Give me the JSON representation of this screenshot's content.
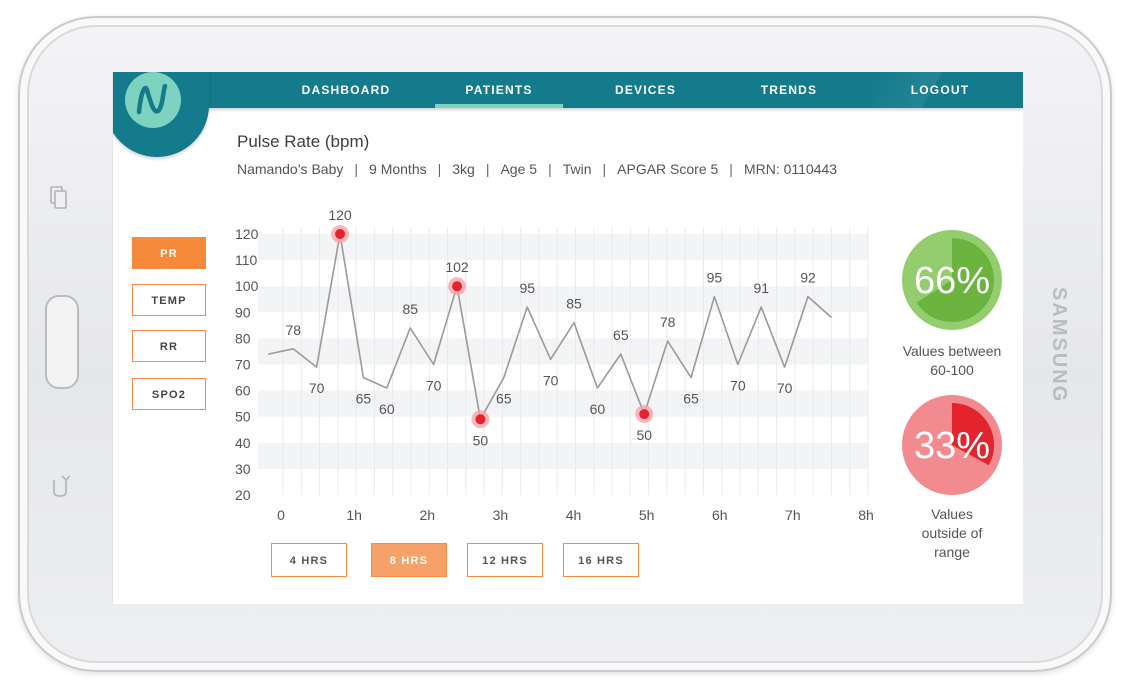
{
  "device": {
    "brand": "SAMSUNG"
  },
  "nav": {
    "items": [
      {
        "label": "DASHBOARD",
        "active": false
      },
      {
        "label": "PATIENTS",
        "active": true
      },
      {
        "label": "DEVICES",
        "active": false
      },
      {
        "label": "TRENDS",
        "active": false
      },
      {
        "label": "LOGOUT",
        "active": false
      }
    ]
  },
  "header": {
    "title": "Pulse Rate (bpm)",
    "meta": [
      "Namando’s Baby",
      "9 Months",
      "3kg",
      "Age 5",
      "Twin",
      "APGAR Score 5",
      "MRN:  0110443"
    ]
  },
  "metrics": [
    {
      "label": "PR",
      "active": true
    },
    {
      "label": "TEMP",
      "active": false
    },
    {
      "label": "RR",
      "active": false
    },
    {
      "label": "SPO2",
      "active": false
    }
  ],
  "ranges": [
    {
      "label": "4 HRS",
      "active": false
    },
    {
      "label": "8 HRS",
      "active": true
    },
    {
      "label": "12 HRS",
      "active": false
    },
    {
      "label": "16 HRS",
      "active": false
    }
  ],
  "chart_data": {
    "type": "line",
    "title": "Pulse Rate (bpm)",
    "xlabel": "",
    "ylabel": "",
    "ylim": [
      20,
      120
    ],
    "xlim": [
      0,
      8
    ],
    "yticks": [
      20,
      30,
      40,
      50,
      60,
      70,
      80,
      90,
      100,
      110,
      120
    ],
    "xticks": [
      "0",
      "1h",
      "2h",
      "3h",
      "4h",
      "5h",
      "6h",
      "7h",
      "8h"
    ],
    "grid": true,
    "points": [
      {
        "x": -0.2,
        "y": 74,
        "label": ""
      },
      {
        "x": 0.14,
        "y": 76,
        "label": "78"
      },
      {
        "x": 0.46,
        "y": 69,
        "label": "70"
      },
      {
        "x": 0.78,
        "y": 120,
        "label": "120",
        "alert": true
      },
      {
        "x": 1.1,
        "y": 65,
        "label": "65"
      },
      {
        "x": 1.42,
        "y": 61,
        "label": "60"
      },
      {
        "x": 1.74,
        "y": 84,
        "label": "85"
      },
      {
        "x": 2.06,
        "y": 70,
        "label": "70"
      },
      {
        "x": 2.38,
        "y": 100,
        "label": "102",
        "alert": true
      },
      {
        "x": 2.7,
        "y": 49,
        "label": "50",
        "alert": true
      },
      {
        "x": 3.02,
        "y": 65,
        "label": "65"
      },
      {
        "x": 3.34,
        "y": 92,
        "label": "95"
      },
      {
        "x": 3.66,
        "y": 72,
        "label": "70"
      },
      {
        "x": 3.98,
        "y": 86,
        "label": "85"
      },
      {
        "x": 4.3,
        "y": 61,
        "label": "60"
      },
      {
        "x": 4.62,
        "y": 74,
        "label": "65"
      },
      {
        "x": 4.94,
        "y": 51,
        "label": "50",
        "alert": true
      },
      {
        "x": 5.26,
        "y": 79,
        "label": "78"
      },
      {
        "x": 5.58,
        "y": 65,
        "label": "65"
      },
      {
        "x": 5.9,
        "y": 96,
        "label": "95"
      },
      {
        "x": 6.22,
        "y": 70,
        "label": "70"
      },
      {
        "x": 6.54,
        "y": 92,
        "label": "91"
      },
      {
        "x": 6.86,
        "y": 69,
        "label": "70"
      },
      {
        "x": 7.18,
        "y": 96,
        "label": "92"
      },
      {
        "x": 7.5,
        "y": 88,
        "label": ""
      }
    ],
    "colors": {
      "line": "#9a9a9a",
      "alert": "#e8212e",
      "alert_halo": "#f7a1a5"
    }
  },
  "stats": [
    {
      "value": 66,
      "text": "66%",
      "label_lines": [
        "Values between",
        "60-100"
      ],
      "color_light": "#94cd6e",
      "color_dark": "#6ab43f"
    },
    {
      "value": 33,
      "text": "33%",
      "label_lines": [
        "Values",
        "outside of",
        "range"
      ],
      "color_light": "#f28b8f",
      "color_dark": "#e4242d"
    }
  ]
}
